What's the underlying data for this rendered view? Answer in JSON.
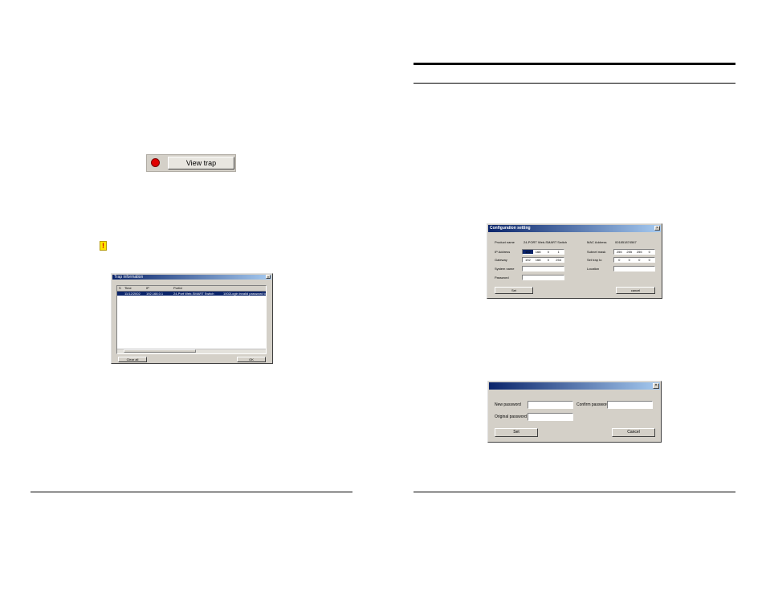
{
  "view_trap": {
    "button_label": "View trap",
    "led_color": "#e00000"
  },
  "warning": {
    "icon": "warning-icon",
    "glyph": "!"
  },
  "trap_window": {
    "title": "Trap information",
    "close_glyph": "×",
    "columns": [
      "S",
      "Time",
      "IP",
      "PortId",
      ""
    ],
    "rows": [
      {
        "time": "11/12/2002",
        "ip": "192.168.0.1",
        "port": "24-Port Web-SMART Switch",
        "desc": "1002Login invalid password to"
      }
    ],
    "clear_all": "Clear all",
    "ok": "OK"
  },
  "config_window": {
    "title": "Configuration setting",
    "close_glyph": "×",
    "product_name_label": "Product name",
    "product_name_value": "24-PORT Web-SMART Switch",
    "mac_label": "MAC Address",
    "mac_value": "001851874567",
    "ip_label": "IP Address",
    "ip": [
      "192",
      "168",
      "0",
      "1"
    ],
    "subnet_label": "Subnet mask",
    "subnet": [
      "255",
      "255",
      "255",
      "0"
    ],
    "gateway_label": "Gateway",
    "gateway": [
      "192",
      "168",
      "0",
      "254"
    ],
    "trap_label": "Set trap to",
    "trap": [
      "0",
      "0",
      "0",
      "0"
    ],
    "system_name_label": "System name",
    "location_label": "Location",
    "password_label": "Password",
    "set": "Set",
    "cancel": "cancel"
  },
  "password_window": {
    "close_glyph": "×",
    "new_password_label": "New password",
    "confirm_password_label": "Confirm password",
    "original_password_label": "Original password",
    "set": "Set",
    "cancel": "Cancel"
  },
  "colors": {
    "title_start": "#0a246a",
    "title_end": "#a6caf0",
    "dialog_bg": "#d4d0c8"
  }
}
